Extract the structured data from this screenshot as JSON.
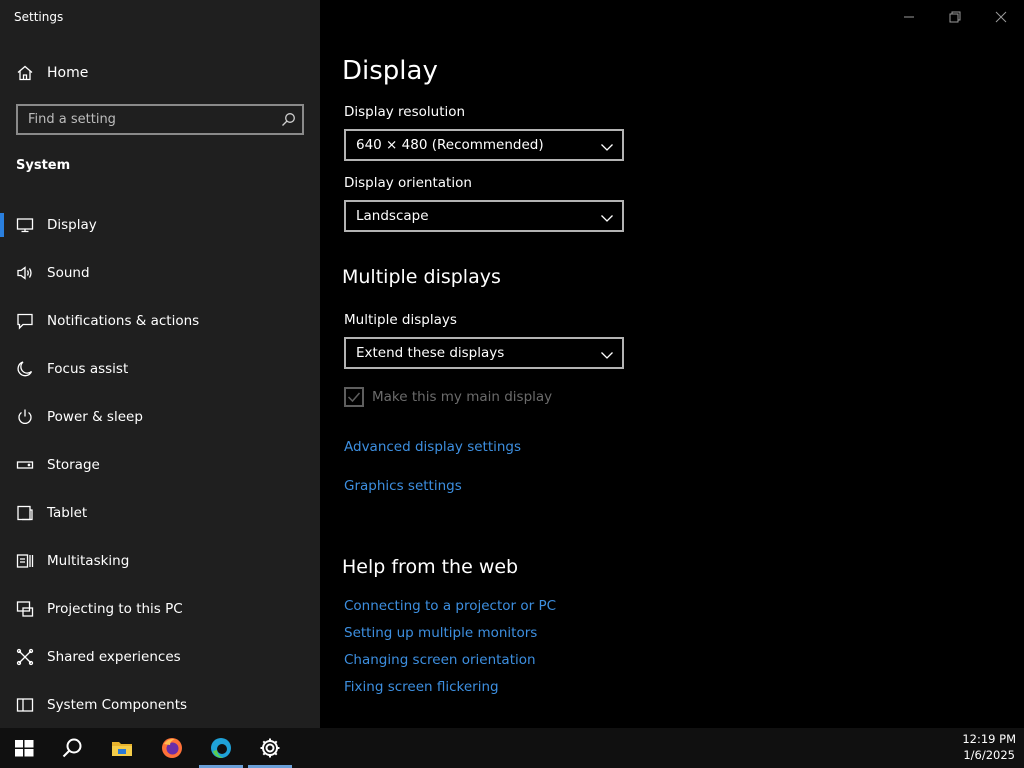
{
  "window": {
    "title": "Settings"
  },
  "sidebar": {
    "home_label": "Home",
    "search_placeholder": "Find a setting",
    "section": "System",
    "items": [
      {
        "label": "Display",
        "icon": "monitor-icon",
        "active": true
      },
      {
        "label": "Sound",
        "icon": "speaker-icon"
      },
      {
        "label": "Notifications & actions",
        "icon": "notification-icon"
      },
      {
        "label": "Focus assist",
        "icon": "moon-icon"
      },
      {
        "label": "Power & sleep",
        "icon": "power-icon"
      },
      {
        "label": "Storage",
        "icon": "storage-icon"
      },
      {
        "label": "Tablet",
        "icon": "tablet-icon"
      },
      {
        "label": "Multitasking",
        "icon": "multitasking-icon"
      },
      {
        "label": "Projecting to this PC",
        "icon": "projecting-icon"
      },
      {
        "label": "Shared experiences",
        "icon": "shared-experiences-icon"
      },
      {
        "label": "System Components",
        "icon": "components-icon"
      }
    ]
  },
  "main": {
    "title": "Display",
    "resolution": {
      "label": "Display resolution",
      "value": "640 × 480 (Recommended)"
    },
    "orientation": {
      "label": "Display orientation",
      "value": "Landscape"
    },
    "multiple_heading": "Multiple displays",
    "multiple": {
      "label": "Multiple displays",
      "value": "Extend these displays"
    },
    "main_display_checkbox": {
      "label": "Make this my main display",
      "checked": true,
      "disabled": true
    },
    "links": {
      "advanced": "Advanced display settings",
      "graphics": "Graphics settings"
    },
    "help_heading": "Help from the web",
    "help_links": [
      "Connecting to a projector or PC",
      "Setting up multiple monitors",
      "Changing screen orientation",
      "Fixing screen flickering"
    ]
  },
  "taskbar": {
    "apps": [
      "windows-start-icon",
      "search-icon",
      "file-explorer-icon",
      "firefox-icon",
      "edge-icon",
      "settings-gear-icon"
    ],
    "time": "12:19 PM",
    "date": "1/6/2025"
  },
  "colors": {
    "accent": "#2a7fde",
    "link": "#3d8fe0",
    "sidebar_bg": "#1f1f1f",
    "main_bg": "#000000"
  }
}
